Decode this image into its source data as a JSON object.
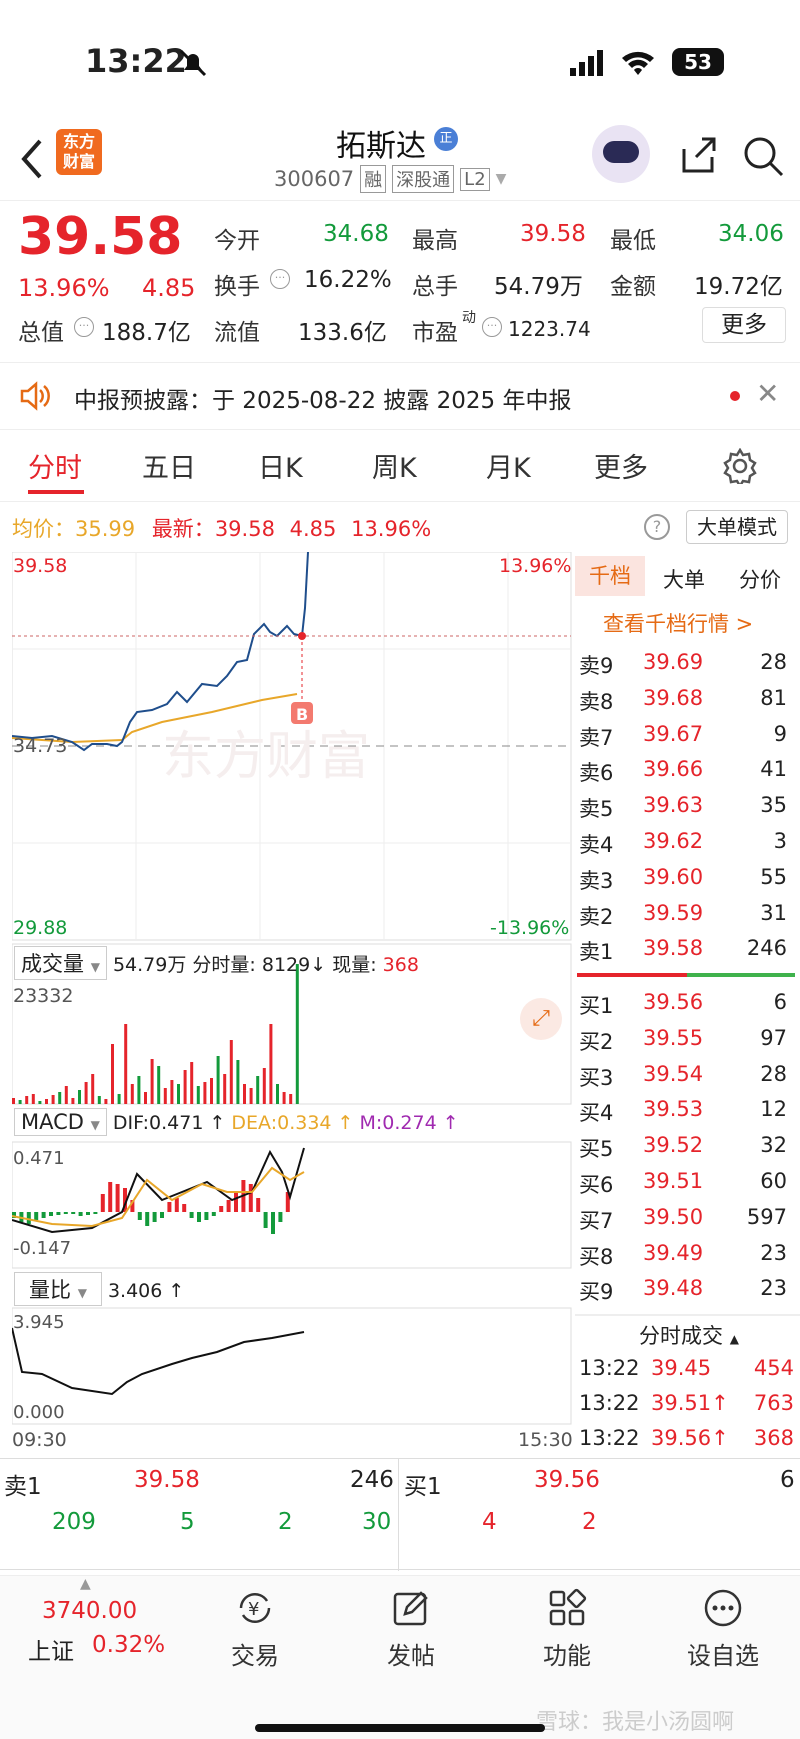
{
  "status_bar": {
    "time": "13:22",
    "battery": "53"
  },
  "header": {
    "logo_line1": "东方",
    "logo_line2": "财富",
    "stock_name": "拓斯达",
    "name_badge": "正",
    "code": "300607",
    "tags": [
      "融",
      "深股通",
      "L2"
    ]
  },
  "quote": {
    "price": "39.58",
    "change_pct": "13.96%",
    "change": "4.85",
    "open_label": "今开",
    "open": "34.68",
    "high_label": "最高",
    "high": "39.58",
    "low_label": "最低",
    "low": "34.06",
    "turnover_label": "换手",
    "turnover": "16.22%",
    "volume_label": "总手",
    "volume": "54.79万",
    "amount_label": "金额",
    "amount": "19.72亿",
    "mktcap_label": "总值",
    "mktcap": "188.7亿",
    "float_label": "流值",
    "float": "133.6亿",
    "pe_label": "市盈",
    "pe_sup": "动",
    "pe": "1223.74",
    "more_label": "更多"
  },
  "notice": {
    "text": "中报预披露：于 2025-08-22 披露 2025 年中报"
  },
  "tabs": [
    "分时",
    "五日",
    "日K",
    "周K",
    "月K",
    "更多"
  ],
  "chart_legend": {
    "avg_label": "均价：",
    "avg": "35.99",
    "last_label": "最新：",
    "last": "39.58",
    "chg": "4.85",
    "pct": "13.96%",
    "mode_label": "大单模式"
  },
  "chart_axis": {
    "top": "39.58",
    "mid": "34.73",
    "bottom": "29.88",
    "top_pct": "13.96%",
    "bottom_pct": "-13.96%",
    "start_time": "09:30",
    "end_time": "15:30",
    "watermark": "东方财富",
    "b_marker": "B"
  },
  "volume_panel": {
    "label": "成交量",
    "total": "54.79万",
    "fenshi_label": "分时量:",
    "fenshi": "8129",
    "now_label": "现量:",
    "now": "368",
    "max": "23332"
  },
  "macd_panel": {
    "label": "MACD",
    "dif": "DIF:0.471",
    "dea": "DEA:0.334",
    "m": "M:0.274",
    "top": "0.471",
    "bottom": "-0.147"
  },
  "ratio_panel": {
    "label": "量比",
    "value": "3.406",
    "top": "3.945",
    "bottom": "0.000"
  },
  "orderbook": {
    "tabs": [
      "千档",
      "大单",
      "分价"
    ],
    "link": "查看千档行情 >",
    "asks": [
      [
        "卖9",
        "39.69",
        "28"
      ],
      [
        "卖8",
        "39.68",
        "81"
      ],
      [
        "卖7",
        "39.67",
        "9"
      ],
      [
        "卖6",
        "39.66",
        "41"
      ],
      [
        "卖5",
        "39.63",
        "35"
      ],
      [
        "卖4",
        "39.62",
        "3"
      ],
      [
        "卖3",
        "39.60",
        "55"
      ],
      [
        "卖2",
        "39.59",
        "31"
      ],
      [
        "卖1",
        "39.58",
        "246"
      ]
    ],
    "bids": [
      [
        "买1",
        "39.56",
        "6"
      ],
      [
        "买2",
        "39.55",
        "97"
      ],
      [
        "买3",
        "39.54",
        "28"
      ],
      [
        "买4",
        "39.53",
        "12"
      ],
      [
        "买5",
        "39.52",
        "32"
      ],
      [
        "买6",
        "39.51",
        "60"
      ],
      [
        "买7",
        "39.50",
        "597"
      ],
      [
        "买8",
        "39.49",
        "23"
      ],
      [
        "买9",
        "39.48",
        "23"
      ]
    ],
    "ticks_label": "分时成交",
    "ticks": [
      [
        "13:22",
        "39.45",
        "454"
      ],
      [
        "13:22",
        "39.51↑",
        "763"
      ],
      [
        "13:22",
        "39.56↑",
        "368"
      ]
    ]
  },
  "bottom_quote": {
    "sell_label": "卖1",
    "sell_price": "39.58",
    "sell_qty": "246",
    "buy_label": "买1",
    "buy_price": "39.56",
    "buy_qty": "6",
    "sell_queue": [
      "209",
      "5",
      "2",
      "30"
    ],
    "buy_queue": [
      "4",
      "2"
    ]
  },
  "nav": {
    "index_value": "3740.00",
    "index_name": "上证",
    "index_pct": "0.32%",
    "items": [
      "交易",
      "发帖",
      "功能",
      "设自选"
    ],
    "watermark": "雪球：我是小汤圆啊"
  },
  "colors": {
    "up": "#e5242b",
    "down": "#139a3b",
    "avg_line": "#e8a72a",
    "price_line": "#1f4e8c"
  }
}
